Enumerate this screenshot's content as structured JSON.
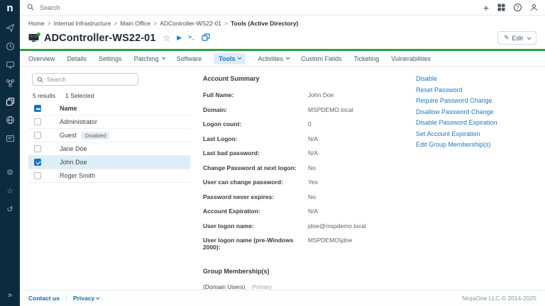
{
  "colors": {
    "sidebar_navy": "#0d2b3e",
    "status_green": "#28a53c",
    "accent_blue": "#1b74bc",
    "active_tab_bg": "#ddedf9",
    "selected_row_bg": "#ddeef9"
  },
  "topbar": {
    "search_placeholder": "Search"
  },
  "breadcrumb": {
    "items": [
      "Home",
      "Internal Infrastructure",
      "Main Office",
      "ADController-WS22-01",
      "Tools (Active Directory)"
    ]
  },
  "device": {
    "name": "ADController-WS22-01",
    "status": "online"
  },
  "toolbar": {
    "edit_label": "Edit"
  },
  "tabs": [
    {
      "label": "Overview"
    },
    {
      "label": "Details"
    },
    {
      "label": "Settings"
    },
    {
      "label": "Patching"
    },
    {
      "label": "Software"
    },
    {
      "label": "Tools"
    },
    {
      "label": "Activities"
    },
    {
      "label": "Custom Fields"
    },
    {
      "label": "Ticketing"
    },
    {
      "label": "Vulnerabilities"
    }
  ],
  "user_list": {
    "search_placeholder": "Search",
    "results": "5 results",
    "selected": "1 Selected",
    "name_header": "Name",
    "rows": [
      {
        "name": "Administrator"
      },
      {
        "name": "Guest",
        "badge": "Disabled"
      },
      {
        "name": "Jane Doe"
      },
      {
        "name": "John Doe"
      },
      {
        "name": "Roger Smith"
      }
    ]
  },
  "account_summary": {
    "title": "Account Summary",
    "fields": [
      {
        "label": "Full Name:",
        "value": "John Doe"
      },
      {
        "label": "Domain:",
        "value": "MSPDEMO.local"
      },
      {
        "label": "Logon count:",
        "value": "0"
      },
      {
        "label": "Last Logon:",
        "value": "N/A"
      },
      {
        "label": "Last bad password:",
        "value": "N/A"
      },
      {
        "label": "Change Password at next logon:",
        "value": "No"
      },
      {
        "label": "User can change password:",
        "value": "Yes"
      },
      {
        "label": "Password never expires:",
        "value": "No"
      },
      {
        "label": "Account Expiration:",
        "value": "N/A"
      },
      {
        "label": "User logon name:",
        "value": "jdoe@mspdemo.local"
      },
      {
        "label": "User logon name (pre-Windows 2000):",
        "value": "MSPDEMO\\jdoe"
      }
    ]
  },
  "group_membership": {
    "title": "Group Membership(s)",
    "entries": [
      {
        "name": "(Domain Users)",
        "tag": "Primary"
      }
    ]
  },
  "actions": [
    {
      "label": "Disable"
    },
    {
      "label": "Reset Password"
    },
    {
      "label": "Require Password Change"
    },
    {
      "label": "Disallow Password Change"
    },
    {
      "label": "Disable Password Expiration"
    },
    {
      "label": "Set Account Expiration"
    },
    {
      "label": "Edit Group Membership(s)"
    }
  ],
  "footer": {
    "contact": "Contact us",
    "privacy": "Privacy",
    "copyright": "NinjaOne LLC © 2014-2025"
  },
  "icons": {
    "plus": "+",
    "gear": "⚙",
    "star": "☆",
    "history": "↺",
    "expand": "»",
    "play": "▶",
    "pencil": "✎",
    "terminal": ">_",
    "help": "?",
    "logo": "n"
  }
}
